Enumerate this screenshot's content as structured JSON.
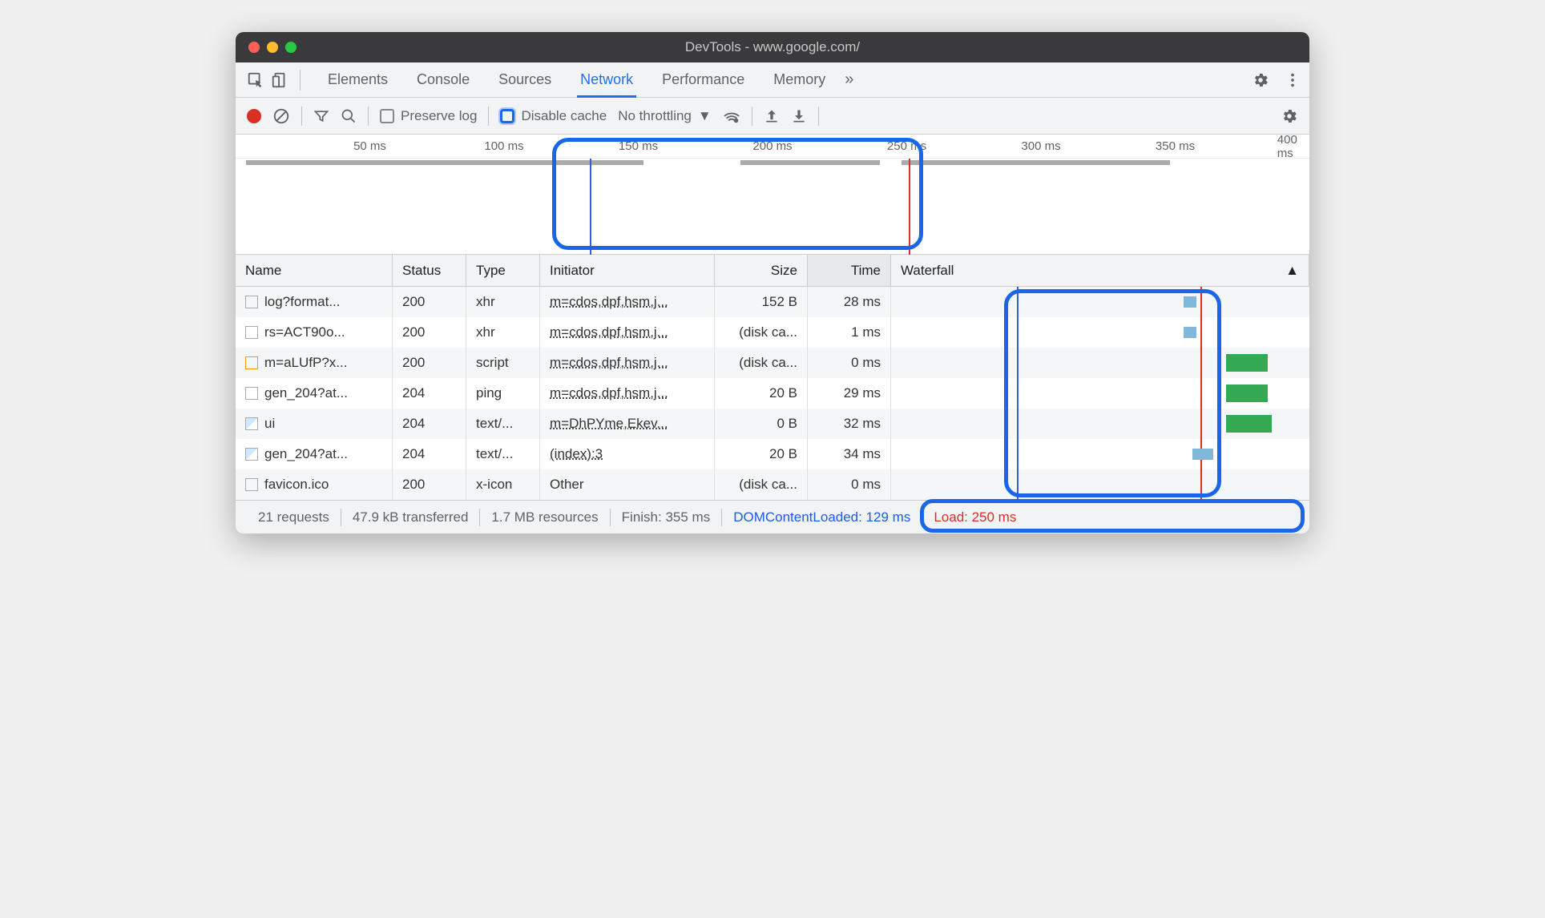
{
  "window": {
    "title": "DevTools - www.google.com/"
  },
  "tabs": {
    "items": [
      "Elements",
      "Console",
      "Sources",
      "Network",
      "Performance",
      "Memory"
    ],
    "active_index": 3
  },
  "toolbar": {
    "preserve_log": "Preserve log",
    "disable_cache": "Disable cache",
    "throttling": "No throttling"
  },
  "timeline": {
    "ticks": [
      "50 ms",
      "100 ms",
      "150 ms",
      "200 ms",
      "250 ms",
      "300 ms",
      "350 ms",
      "400 ms"
    ]
  },
  "columns": {
    "name": "Name",
    "status": "Status",
    "type": "Type",
    "initiator": "Initiator",
    "size": "Size",
    "time": "Time",
    "waterfall": "Waterfall"
  },
  "rows": [
    {
      "name": "log?format...",
      "status": "200",
      "type": "xhr",
      "initiator": "m=cdos,dpf,hsm,j...",
      "size": "152 B",
      "time": "28 ms",
      "icon": "blank"
    },
    {
      "name": "rs=ACT90o...",
      "status": "200",
      "type": "xhr",
      "initiator": "m=cdos,dpf,hsm,j...",
      "size": "(disk ca...",
      "time": "1 ms",
      "icon": "blank"
    },
    {
      "name": "m=aLUfP?x...",
      "status": "200",
      "type": "script",
      "initiator": "m=cdos,dpf,hsm,j...",
      "size": "(disk ca...",
      "time": "0 ms",
      "icon": "orange"
    },
    {
      "name": "gen_204?at...",
      "status": "204",
      "type": "ping",
      "initiator": "m=cdos,dpf,hsm,j...",
      "size": "20 B",
      "time": "29 ms",
      "icon": "blank"
    },
    {
      "name": "ui",
      "status": "204",
      "type": "text/...",
      "initiator": "m=DhPYme,Ekev...",
      "size": "0 B",
      "time": "32 ms",
      "icon": "img"
    },
    {
      "name": "gen_204?at...",
      "status": "204",
      "type": "text/...",
      "initiator": "(index):3",
      "size": "20 B",
      "time": "34 ms",
      "icon": "img"
    },
    {
      "name": "favicon.ico",
      "status": "200",
      "type": "x-icon",
      "initiator": "Other",
      "size": "(disk ca...",
      "time": "0 ms",
      "icon": "blank"
    }
  ],
  "summary": {
    "requests": "21 requests",
    "transferred": "47.9 kB transferred",
    "resources": "1.7 MB resources",
    "finish": "Finish: 355 ms",
    "dcl": "DOMContentLoaded: 129 ms",
    "load": "Load: 250 ms"
  }
}
